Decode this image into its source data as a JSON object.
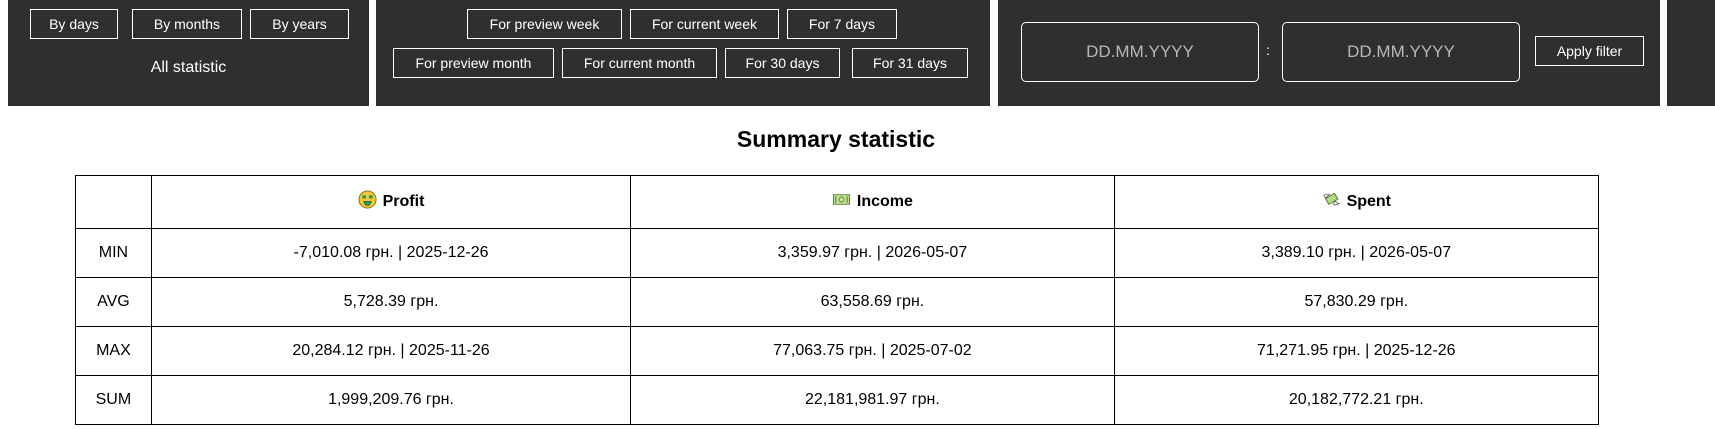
{
  "period_panel": {
    "buttons": [
      "By days",
      "By months",
      "By years"
    ],
    "caption": "All statistic"
  },
  "quick_filters": {
    "row1": [
      "For preview week",
      "For current week",
      "For 7 days"
    ],
    "row2": [
      "For preview month",
      "For current month",
      "For 30 days",
      "For 31 days"
    ]
  },
  "date_filter": {
    "from_placeholder": "DD.MM.YYYY",
    "separator": ":",
    "to_placeholder": "DD.MM.YYYY",
    "apply_label": "Apply filter"
  },
  "summary": {
    "title": "Summary statistic",
    "columns": [
      {
        "label": "Profit",
        "icon": "money-mouth-face-icon"
      },
      {
        "label": "Income",
        "icon": "banknote-icon"
      },
      {
        "label": "Spent",
        "icon": "money-with-wings-icon"
      }
    ],
    "rows": [
      {
        "label": "MIN",
        "values": [
          "-7,010.08 грн. | 2025-12-26",
          "3,359.97 грн. | 2026-05-07",
          "3,389.10 грн. | 2026-05-07"
        ]
      },
      {
        "label": "AVG",
        "values": [
          "5,728.39 грн.",
          "63,558.69 грн.",
          "57,830.29 грн."
        ]
      },
      {
        "label": "MAX",
        "values": [
          "20,284.12 грн. | 2025-11-26",
          "77,063.75 грн. | 2025-07-02",
          "71,271.95 грн. | 2025-12-26"
        ]
      },
      {
        "label": "SUM",
        "values": [
          "1,999,209.76 грн.",
          "22,181,981.97 грн.",
          "20,182,772.21 грн."
        ]
      }
    ]
  }
}
